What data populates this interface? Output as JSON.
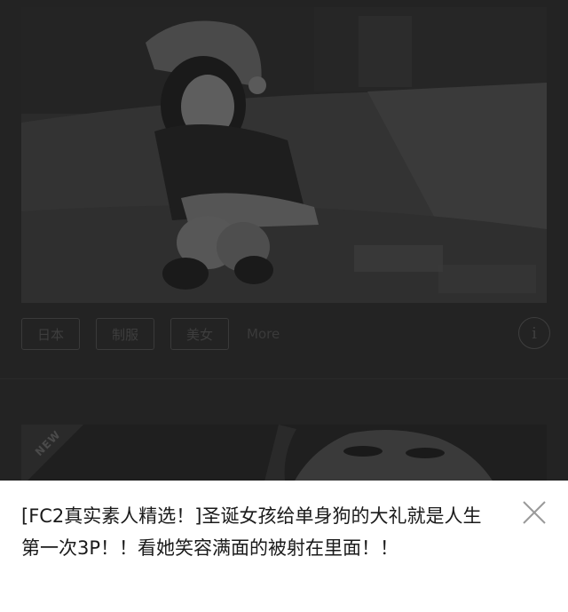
{
  "tags": [
    {
      "label": "日本"
    },
    {
      "label": "制服"
    },
    {
      "label": "美女"
    }
  ],
  "more_label": "More",
  "info_glyph": "i",
  "card2": {
    "badge": "NEW"
  },
  "sheet": {
    "title": "[FC2真实素人精选！]圣诞女孩给单身狗的大礼就是人生第一次3P！！看她笑容满面的被射在里面！！"
  },
  "icons": {
    "info": "info-icon",
    "close": "close-icon"
  }
}
